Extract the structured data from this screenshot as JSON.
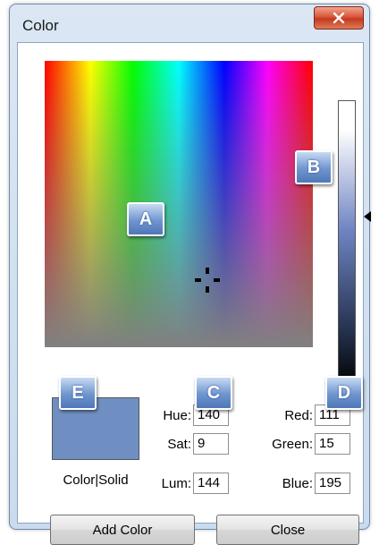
{
  "window": {
    "title": "Color"
  },
  "fields": {
    "hue": {
      "label": "Hue:",
      "value": "140"
    },
    "sat": {
      "label": "Sat:",
      "value": "9"
    },
    "lum": {
      "label": "Lum:",
      "value": "144"
    },
    "red": {
      "label": "Red:",
      "value": "111"
    },
    "green": {
      "label": "Green:",
      "value": "15"
    },
    "blue": {
      "label": "Blue:",
      "value": "195"
    }
  },
  "swatch": {
    "label": "Color|Solid",
    "color": "#6f8fc3"
  },
  "buttons": {
    "add_color": "Add Color",
    "close": "Close"
  },
  "callouts": {
    "a": "A",
    "b": "B",
    "c": "C",
    "d": "D",
    "e": "E"
  },
  "icons": {
    "close": "close-x-icon",
    "crosshair": "crosshair-icon",
    "slider_arrow": "slider-arrow-icon"
  }
}
